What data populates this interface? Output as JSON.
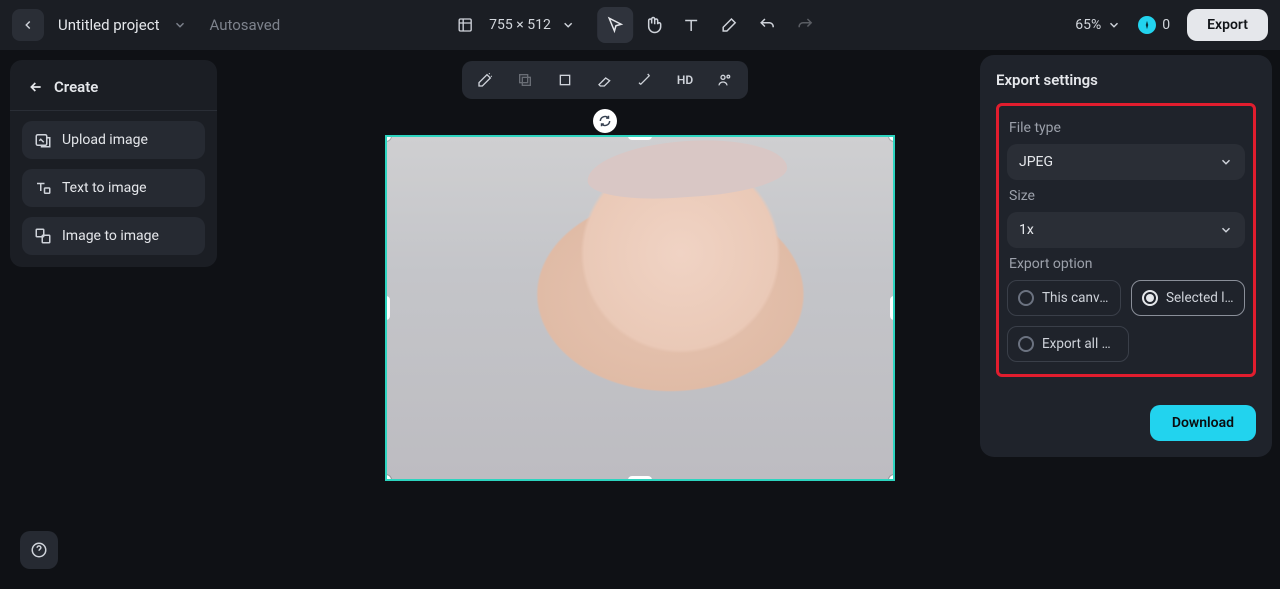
{
  "header": {
    "project_title": "Untitled project",
    "autosaved": "Autosaved",
    "dimensions": "755 × 512",
    "zoom": "65%",
    "credits": "0",
    "export_label": "Export"
  },
  "sidebar": {
    "create_label": "Create",
    "upload_label": "Upload image",
    "text_to_image_label": "Text to image",
    "image_to_image_label": "Image to image"
  },
  "floating": {
    "hd_label": "HD"
  },
  "export_panel": {
    "title": "Export settings",
    "file_type_label": "File type",
    "file_type_value": "JPEG",
    "size_label": "Size",
    "size_value": "1x",
    "export_option_label": "Export option",
    "this_canvas": "This canvas",
    "selected_layer": "Selected l…",
    "export_all": "Export all …",
    "download_label": "Download"
  },
  "icons": {
    "chevron_left": "chevron-left",
    "chevron_down": "chevron-down"
  }
}
